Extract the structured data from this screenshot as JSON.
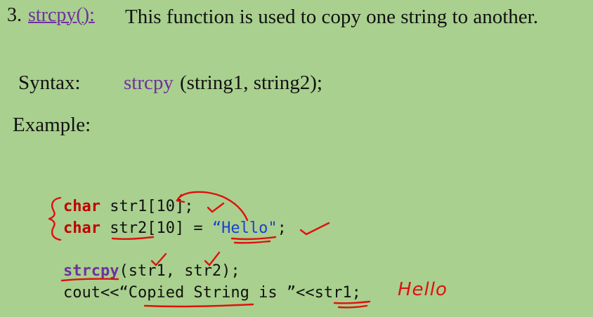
{
  "heading": {
    "number": "3.",
    "function_name": "strcpy():",
    "description": "This function is used to copy one string to another."
  },
  "syntax": {
    "label": "Syntax:",
    "function_name": "strcpy",
    "arguments": "(string1, string2);"
  },
  "example": {
    "label": "Example:"
  },
  "code": {
    "line1": {
      "keyword": "char",
      "rest": " str1[10];"
    },
    "line2": {
      "keyword": "char",
      "middle": " str2[10] = ",
      "string": "“Hello\"",
      "end": ";"
    },
    "line3": {
      "function": "strcpy",
      "rest": "(str1, str2);"
    },
    "line4": {
      "text": "cout<<“Copied String is ”<<str1;"
    }
  },
  "annotation": {
    "handwritten": "Hello",
    "color": "#e01010"
  },
  "colors": {
    "background": "#a9d08e",
    "function_purple": "#7030a0",
    "keyword_red": "#c00000",
    "string_blue": "#1f3fd0"
  }
}
